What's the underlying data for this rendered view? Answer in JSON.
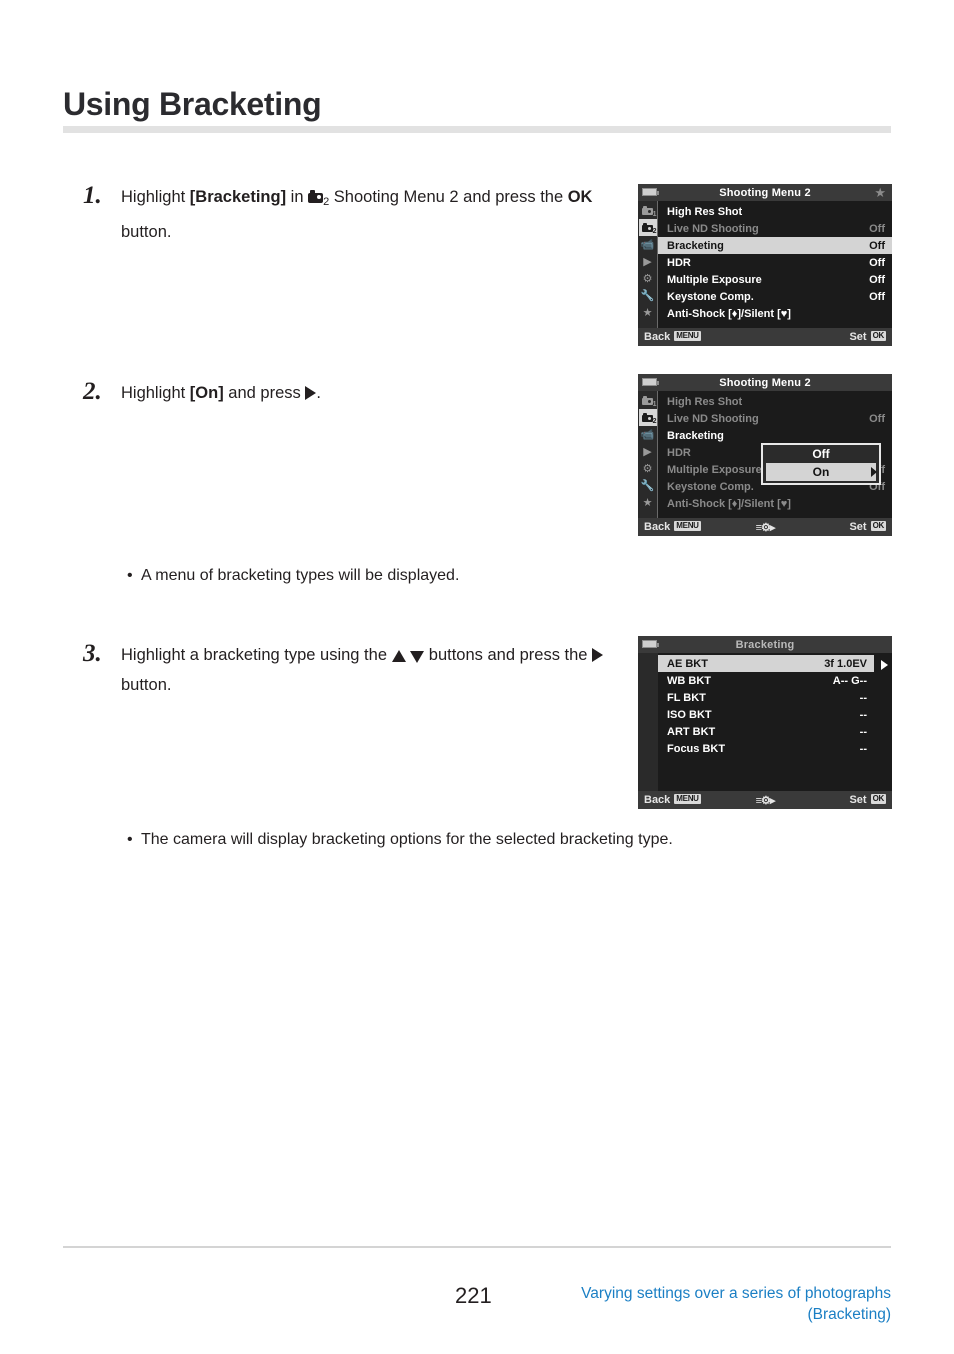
{
  "page": {
    "title": "Using Bracketing",
    "number": "221",
    "footer_link_line1": "Varying settings over a series of photographs",
    "footer_link_line2": "(Bracketing)",
    "link_color": "#1b7fc4",
    "rule_color": "#e2e2e2"
  },
  "steps": [
    {
      "number": "1.",
      "text_a": "Highlight ",
      "text_bracket": "[Bracketing]",
      "text_b": " in ",
      "icon": "camera-2-icon",
      "icon_sub": "2",
      "text_c": " Shooting Menu 2 and press the ",
      "text_bold2": "OK",
      "text_d": " button."
    },
    {
      "number": "2.",
      "text_a": "Highlight ",
      "text_bracket": "[On]",
      "text_b": " and press ",
      "icon": "arrow-right-icon",
      "text_c": "."
    },
    {
      "number": "3.",
      "text_a": "Highlight a bracketing type using the ",
      "icon_up": "arrow-up-icon",
      "icon_down": "arrow-down-icon",
      "text_b": " buttons and press the ",
      "icon_right": "arrow-right-icon",
      "text_c": " button."
    }
  ],
  "bullets": [
    {
      "text": "A menu of bracketing types will be displayed."
    },
    {
      "text": "The camera will display bracketing options for the selected bracketing type."
    }
  ],
  "screens": [
    {
      "id": "shooting-menu-2-step1",
      "title": "Shooting Menu 2",
      "title_dim": false,
      "star": "★",
      "sidebar": [
        {
          "name": "camera-1-icon",
          "sub": "1",
          "active": false
        },
        {
          "name": "camera-2-icon",
          "sub": "2",
          "active": true
        },
        {
          "name": "movie-icon",
          "sub": "",
          "active": false
        },
        {
          "name": "playback-icon",
          "sub": "",
          "active": false
        },
        {
          "name": "gear-icon",
          "sub": "",
          "active": false
        },
        {
          "name": "wrench-icon",
          "sub": "",
          "active": false
        },
        {
          "name": "star-icon",
          "sub": "",
          "active": false
        }
      ],
      "rows": [
        {
          "label": "High Res Shot",
          "value": "",
          "state": "normal"
        },
        {
          "label": "Live ND Shooting",
          "value": "Off",
          "state": "dim"
        },
        {
          "label": "Bracketing",
          "value": "Off",
          "state": "selected"
        },
        {
          "label": "HDR",
          "value": "Off",
          "state": "normal"
        },
        {
          "label": "Multiple Exposure",
          "value": "Off",
          "state": "normal"
        },
        {
          "label": "Keystone Comp.",
          "value": "Off",
          "state": "normal"
        },
        {
          "label": "Anti-Shock [♦]/Silent [♥]",
          "value": "",
          "state": "normal"
        }
      ],
      "bottom": {
        "back_label": "Back",
        "back_tag": "MENU",
        "center_glyph": "",
        "set_label": "Set",
        "set_tag": "OK"
      },
      "popup": null
    },
    {
      "id": "shooting-menu-2-step2",
      "title": "Shooting Menu 2",
      "title_dim": false,
      "star": "",
      "sidebar": [
        {
          "name": "camera-1-icon",
          "sub": "1",
          "active": false
        },
        {
          "name": "camera-2-icon",
          "sub": "2",
          "active": true
        },
        {
          "name": "movie-icon",
          "sub": "",
          "active": false
        },
        {
          "name": "playback-icon",
          "sub": "",
          "active": false
        },
        {
          "name": "gear-icon",
          "sub": "",
          "active": false
        },
        {
          "name": "wrench-icon",
          "sub": "",
          "active": false
        },
        {
          "name": "star-icon",
          "sub": "",
          "active": false
        }
      ],
      "rows": [
        {
          "label": "High Res Shot",
          "value": "",
          "state": "dim"
        },
        {
          "label": "Live ND Shooting",
          "value": "Off",
          "state": "dim"
        },
        {
          "label": "Bracketing",
          "value": "",
          "state": "normal"
        },
        {
          "label": "HDR",
          "value": "",
          "state": "dim"
        },
        {
          "label": "Multiple Exposure",
          "value": "Off",
          "state": "dim"
        },
        {
          "label": "Keystone Comp.",
          "value": "Off",
          "state": "dim"
        },
        {
          "label": "Anti-Shock [♦]/Silent [♥]",
          "value": "",
          "state": "dim"
        }
      ],
      "bottom": {
        "back_label": "Back",
        "back_tag": "MENU",
        "center_glyph": "menu-gear-right-icon",
        "set_label": "Set",
        "set_tag": "OK"
      },
      "popup": {
        "options": [
          {
            "label": "Off",
            "selected": false
          },
          {
            "label": "On",
            "selected": true
          }
        ]
      }
    },
    {
      "id": "bracketing-menu",
      "title": "Bracketing",
      "title_dim": true,
      "star": "",
      "sidebar": [],
      "rows": [
        {
          "label": "AE BKT",
          "value": "3f 1.0EV",
          "state": "selected",
          "arrow": true
        },
        {
          "label": "WB BKT",
          "value": "A-- G--",
          "state": "normal"
        },
        {
          "label": "FL BKT",
          "value": "--",
          "state": "normal"
        },
        {
          "label": "ISO BKT",
          "value": "--",
          "state": "normal"
        },
        {
          "label": "ART BKT",
          "value": "--",
          "state": "normal"
        },
        {
          "label": "Focus BKT",
          "value": "--",
          "state": "normal"
        }
      ],
      "bottom": {
        "back_label": "Back",
        "back_tag": "MENU",
        "center_glyph": "menu-gear-right-icon",
        "set_label": "Set",
        "set_tag": "OK"
      },
      "popup": null
    }
  ]
}
